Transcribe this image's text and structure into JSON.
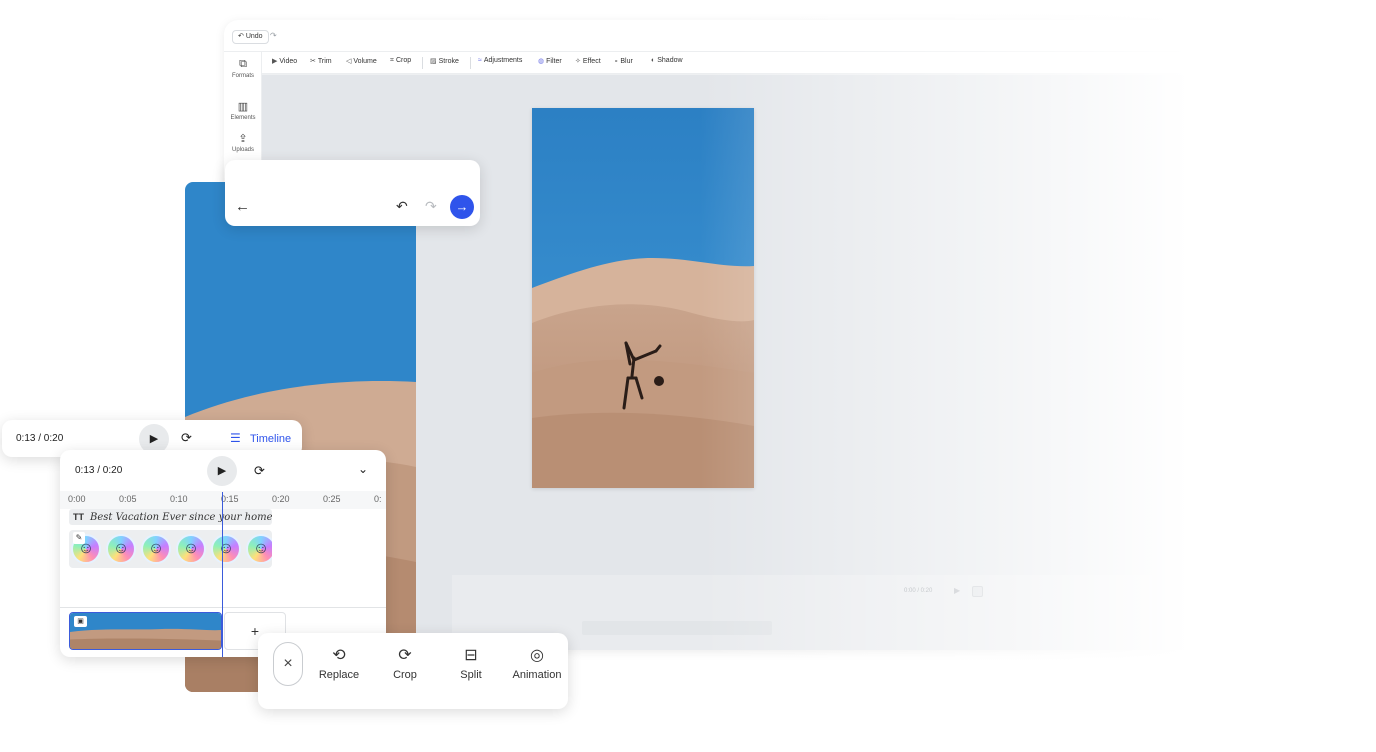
{
  "editor": {
    "undo_label": "Undo",
    "sidebar": [
      {
        "icon": "formats-icon",
        "label": "Formats"
      },
      {
        "icon": "elements-icon",
        "label": "Elements"
      },
      {
        "icon": "upload-icon",
        "label": "Uploads"
      }
    ],
    "toolbar": [
      "Video",
      "Trim",
      "Volume",
      "Crop",
      "Stroke",
      "Adjustments",
      "Filter",
      "Effect",
      "Blur",
      "Shadow"
    ],
    "ghost_time": "0:00 / 0:20"
  },
  "mini_player": {
    "time": "0:13 / 0:20",
    "timeline_label": "Timeline"
  },
  "timeline": {
    "time": "0:13 / 0:20",
    "ruler": [
      "0:00",
      "0:05",
      "0:10",
      "0:15",
      "0:20",
      "0:25",
      "0:"
    ],
    "text_track": "Best Vacation Ever since your home.",
    "text_track_icon": "TT",
    "sticker_count": 6,
    "add_label": "+"
  },
  "actions": {
    "close": "×",
    "items": [
      {
        "icon": "replace-icon",
        "label": "Replace"
      },
      {
        "icon": "crop-icon",
        "label": "Crop"
      },
      {
        "icon": "split-icon",
        "label": "Split"
      },
      {
        "icon": "animation-icon",
        "label": "Animation"
      }
    ]
  },
  "colors": {
    "accent": "#2f54eb",
    "sky": "#2f86c9",
    "sand": "#c39a80"
  }
}
